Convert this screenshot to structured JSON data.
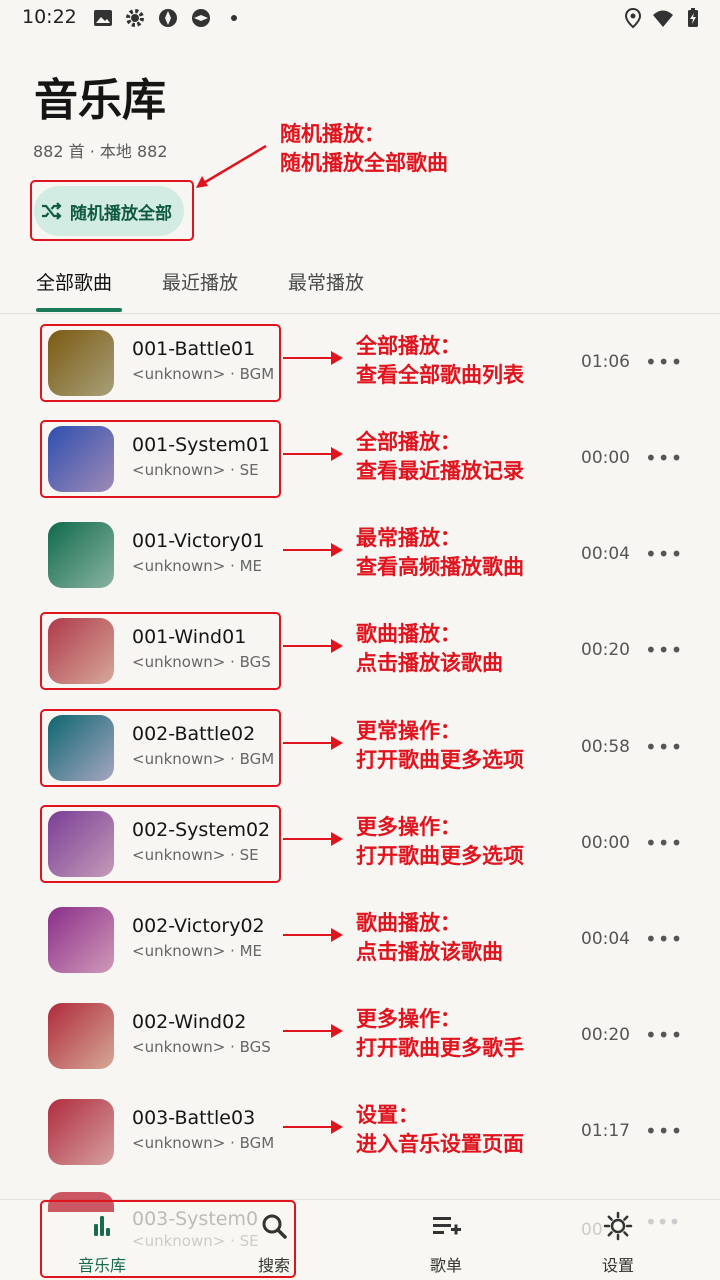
{
  "status_bar": {
    "time": "10:22",
    "left_icons": [
      "image-icon",
      "gear-icon",
      "app-icon",
      "app-icon",
      "dot-icon"
    ],
    "right_icons": [
      "location-icon",
      "wifi-icon",
      "battery-icon"
    ]
  },
  "header": {
    "title": "音乐库",
    "count": "882 首 · 本地 882",
    "shuffle_label": "随机播放全部"
  },
  "tabs": [
    {
      "label": "全部歌曲",
      "active": true
    },
    {
      "label": "最近播放",
      "active": false
    },
    {
      "label": "最常播放",
      "active": false
    }
  ],
  "songs": [
    {
      "title": "001-Battle01",
      "subtitle": "<unknown> · BGM",
      "duration": "01:06",
      "color_a": "#7a5a10",
      "color_b": "#a8a07a"
    },
    {
      "title": "001-System01",
      "subtitle": "<unknown> · SE",
      "duration": "00:00",
      "color_a": "#2e4fb0",
      "color_b": "#a08ab6"
    },
    {
      "title": "001-Victory01",
      "subtitle": "<unknown> · ME",
      "duration": "00:04",
      "color_a": "#0f6a4c",
      "color_b": "#8ab4a2"
    },
    {
      "title": "001-Wind01",
      "subtitle": "<unknown> · BGS",
      "duration": "00:20",
      "color_a": "#b03a4a",
      "color_b": "#d6a89a"
    },
    {
      "title": "002-Battle02",
      "subtitle": "<unknown> · BGM",
      "duration": "00:58",
      "color_a": "#0e6670",
      "color_b": "#a6a6c0"
    },
    {
      "title": "002-System02",
      "subtitle": "<unknown> · SE",
      "duration": "00:00",
      "color_a": "#7a3e96",
      "color_b": "#c49ab8"
    },
    {
      "title": "002-Victory02",
      "subtitle": "<unknown> · ME",
      "duration": "00:04",
      "color_a": "#8a2e8a",
      "color_b": "#d09ab8"
    },
    {
      "title": "002-Wind02",
      "subtitle": "<unknown> · BGS",
      "duration": "00:20",
      "color_a": "#b02a3c",
      "color_b": "#d6a896"
    },
    {
      "title": "003-Battle03",
      "subtitle": "<unknown> · BGM",
      "duration": "01:17",
      "color_a": "#b02c3e",
      "color_b": "#d6a0a0"
    }
  ],
  "partial_song": {
    "title": "003-System0",
    "subtitle": "<unknown> · SE",
    "duration": "00"
  },
  "annotations": {
    "shuffle": [
      "随机播放：",
      "随机播放全部歌曲"
    ],
    "rows": [
      [
        "全部播放：",
        "查看全部歌曲列表"
      ],
      [
        "全部播放：",
        "查看最近播放记录"
      ],
      [
        "最常播放：",
        "查看高频播放歌曲"
      ],
      [
        "歌曲播放：",
        "点击播放该歌曲"
      ],
      [
        "更常操作：",
        "打开歌曲更多选项"
      ],
      [
        "更多操作：",
        "打开歌曲更多选项"
      ],
      [
        "歌曲播放：",
        "点击播放该歌曲"
      ],
      [
        "更多操作：",
        "打开歌曲更多歌手"
      ],
      [
        "设置：",
        "进入音乐设置页面"
      ]
    ]
  },
  "bottom_nav": [
    {
      "label": "音乐库",
      "icon": "bar-chart-icon",
      "active": true
    },
    {
      "label": "搜索",
      "icon": "search-icon",
      "active": false
    },
    {
      "label": "歌单",
      "icon": "playlist-add-icon",
      "active": false
    },
    {
      "label": "设置",
      "icon": "settings-icon",
      "active": false
    }
  ],
  "colors": {
    "accent": "#1a7a5a",
    "annotation": "#e0141e",
    "shuffle_bg": "#d3ece3"
  }
}
